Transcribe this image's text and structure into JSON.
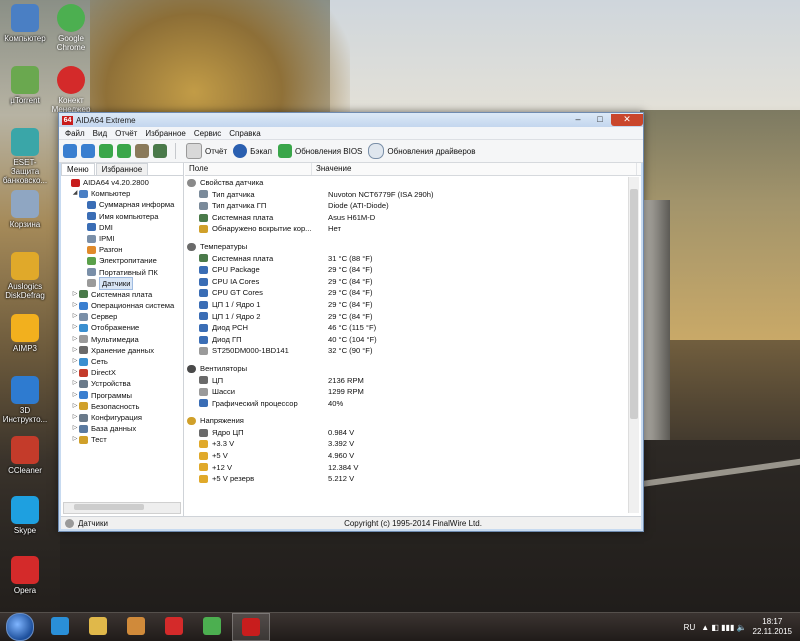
{
  "desktop": {
    "icons_left": [
      {
        "label": "Компьютер",
        "color": "#4a7fc4",
        "icon": "computer-icon"
      },
      {
        "label": "µTorrent",
        "color": "#6aa84f",
        "icon": "utorrent-icon"
      },
      {
        "label": "ESET-Защита банковско...",
        "color": "#3aa6a8",
        "icon": "eset-icon"
      },
      {
        "label": "Корзина",
        "color": "#8fa6c2",
        "icon": "recycle-bin-icon"
      },
      {
        "label": "Auslogics DiskDefrag",
        "color": "#e0a92a",
        "icon": "diskdefrag-icon"
      },
      {
        "label": "AIMP3",
        "color": "#f2b01e",
        "icon": "aimp-icon"
      },
      {
        "label": "3D Инструкто...",
        "color": "#2e7bd0",
        "icon": "3d-instructor-icon"
      },
      {
        "label": "CCleaner",
        "color": "#c43b2a",
        "icon": "ccleaner-icon"
      },
      {
        "label": "Skype",
        "color": "#1ea0e0",
        "icon": "skype-icon"
      },
      {
        "label": "Opera",
        "color": "#d42a2a",
        "icon": "opera-icon"
      }
    ],
    "icons_right": [
      {
        "label": "Google Chrome",
        "color": "#4caf50",
        "icon": "chrome-icon"
      },
      {
        "label": "Конект Менеджер",
        "color": "#d42a2a",
        "icon": "connect-manager-icon"
      }
    ]
  },
  "window": {
    "title": "AIDA64 Extreme",
    "app_icon_text": "64",
    "menu": [
      "Файл",
      "Вид",
      "Отчёт",
      "Избранное",
      "Сервис",
      "Справка"
    ],
    "toolbar": {
      "report": "Отчёт",
      "backup": "Бэкап",
      "bios_update": "Обновления BIOS",
      "driver_update": "Обновления драйверов"
    },
    "tabs": [
      "Меню",
      "Избранное"
    ],
    "tree": [
      {
        "label": "AIDA64 v4.20.2800",
        "level": 0,
        "exp": "",
        "color": "#c81d1d"
      },
      {
        "label": "Компьютер",
        "level": 1,
        "exp": "◢",
        "color": "#4a7fc4"
      },
      {
        "label": "Суммарная информа",
        "level": 2,
        "exp": "",
        "color": "#3a6db5"
      },
      {
        "label": "Имя компьютера",
        "level": 2,
        "exp": "",
        "color": "#3a6db5"
      },
      {
        "label": "DMI",
        "level": 2,
        "exp": "",
        "color": "#3a6db5"
      },
      {
        "label": "IPMI",
        "level": 2,
        "exp": "",
        "color": "#7a8fa8"
      },
      {
        "label": "Разгон",
        "level": 2,
        "exp": "",
        "color": "#e08a2a"
      },
      {
        "label": "Электропитание",
        "level": 2,
        "exp": "",
        "color": "#5aa04a"
      },
      {
        "label": "Портативный ПК",
        "level": 2,
        "exp": "",
        "color": "#7a8fa8"
      },
      {
        "label": "Датчики",
        "level": 2,
        "exp": "",
        "color": "#9a9a9a",
        "selected": true
      },
      {
        "label": "Системная плата",
        "level": 1,
        "exp": "▷",
        "color": "#4a7a4a"
      },
      {
        "label": "Операционная система",
        "level": 1,
        "exp": "▷",
        "color": "#3a7fd0"
      },
      {
        "label": "Сервер",
        "level": 1,
        "exp": "▷",
        "color": "#7a8fa8"
      },
      {
        "label": "Отображение",
        "level": 1,
        "exp": "▷",
        "color": "#3a8fd0"
      },
      {
        "label": "Мультимедиа",
        "level": 1,
        "exp": "▷",
        "color": "#9a9a9a"
      },
      {
        "label": "Хранение данных",
        "level": 1,
        "exp": "▷",
        "color": "#6a6a6a"
      },
      {
        "label": "Сеть",
        "level": 1,
        "exp": "▷",
        "color": "#3a8fd0"
      },
      {
        "label": "DirectX",
        "level": 1,
        "exp": "▷",
        "color": "#c43b2a"
      },
      {
        "label": "Устройства",
        "level": 1,
        "exp": "▷",
        "color": "#6a7a8a"
      },
      {
        "label": "Программы",
        "level": 1,
        "exp": "▷",
        "color": "#3a7fd0"
      },
      {
        "label": "Безопасность",
        "level": 1,
        "exp": "▷",
        "color": "#d0a02a"
      },
      {
        "label": "Конфигурация",
        "level": 1,
        "exp": "▷",
        "color": "#6a7a8a"
      },
      {
        "label": "База данных",
        "level": 1,
        "exp": "▷",
        "color": "#5a7aa0"
      },
      {
        "label": "Тест",
        "level": 1,
        "exp": "▷",
        "color": "#d0a02a"
      }
    ],
    "columns": {
      "field": "Поле",
      "value": "Значение"
    },
    "rows": [
      {
        "type": "group",
        "field": "Свойства датчика",
        "color": "#8a8a8a"
      },
      {
        "field": "Тип датчика",
        "value": "Nuvoton NCT6779F  (ISA 290h)",
        "color": "#7a8a9a"
      },
      {
        "field": "Тип датчика ГП",
        "value": "Diode  (ATI-Diode)",
        "color": "#7a8a9a"
      },
      {
        "field": "Системная плата",
        "value": "Asus H61M-D",
        "color": "#4a7a4a"
      },
      {
        "field": "Обнаружено вскрытие кор...",
        "value": "Нет",
        "color": "#d0a02a"
      },
      {
        "type": "blank"
      },
      {
        "type": "group",
        "field": "Температуры",
        "color": "#6a6a6a"
      },
      {
        "field": "Системная плата",
        "value": "31 °C  (88 °F)",
        "color": "#4a7a4a"
      },
      {
        "field": "CPU Package",
        "value": "29 °C  (84 °F)",
        "color": "#3a6db5"
      },
      {
        "field": "CPU IA Cores",
        "value": "29 °C  (84 °F)",
        "color": "#3a6db5"
      },
      {
        "field": "CPU GT Cores",
        "value": "29 °C  (84 °F)",
        "color": "#3a6db5"
      },
      {
        "field": "ЦП 1 / Ядро 1",
        "value": "29 °C  (84 °F)",
        "color": "#3a6db5"
      },
      {
        "field": "ЦП 1 / Ядро 2",
        "value": "29 °C  (84 °F)",
        "color": "#3a6db5"
      },
      {
        "field": "Диод PCH",
        "value": "46 °C  (115 °F)",
        "color": "#3a6db5"
      },
      {
        "field": "Диод ГП",
        "value": "40 °C  (104 °F)",
        "color": "#3a6db5"
      },
      {
        "field": "ST250DM000-1BD141",
        "value": "32 °C  (90 °F)",
        "color": "#9a9a9a"
      },
      {
        "type": "blank"
      },
      {
        "type": "group",
        "field": "Вентиляторы",
        "color": "#4a4a4a"
      },
      {
        "field": "ЦП",
        "value": "2136 RPM",
        "color": "#6a6a6a"
      },
      {
        "field": "Шасси",
        "value": "1299 RPM",
        "color": "#9a9a9a"
      },
      {
        "field": "Графический процессор",
        "value": "40%",
        "color": "#3a6db5"
      },
      {
        "type": "blank"
      },
      {
        "type": "group",
        "field": "Напряжения",
        "color": "#d0a02a"
      },
      {
        "field": "Ядро ЦП",
        "value": "0.984 V",
        "color": "#6a6a6a"
      },
      {
        "field": "+3.3 V",
        "value": "3.392 V",
        "color": "#e0a92a"
      },
      {
        "field": "+5 V",
        "value": "4.960 V",
        "color": "#e0a92a"
      },
      {
        "field": "+12 V",
        "value": "12.384 V",
        "color": "#e0a92a"
      },
      {
        "field": "+5 V резерв",
        "value": "5.212 V",
        "color": "#e0a92a"
      }
    ],
    "status": {
      "left": "Датчики",
      "center": "Copyright (c) 1995-2014 FinalWire Ltd."
    }
  },
  "taskbar": {
    "buttons": [
      {
        "icon": "internet-explorer-icon",
        "color": "#2a8fd8"
      },
      {
        "icon": "file-explorer-icon",
        "color": "#e0b84a"
      },
      {
        "icon": "media-player-icon",
        "color": "#d08a3a"
      },
      {
        "icon": "opera-icon",
        "color": "#d42a2a"
      },
      {
        "icon": "chrome-icon",
        "color": "#4caf50"
      },
      {
        "icon": "aida64-icon",
        "color": "#c81d1d",
        "active": true
      }
    ],
    "language": "RU",
    "time": "18:17",
    "date": "22.11.2015"
  }
}
